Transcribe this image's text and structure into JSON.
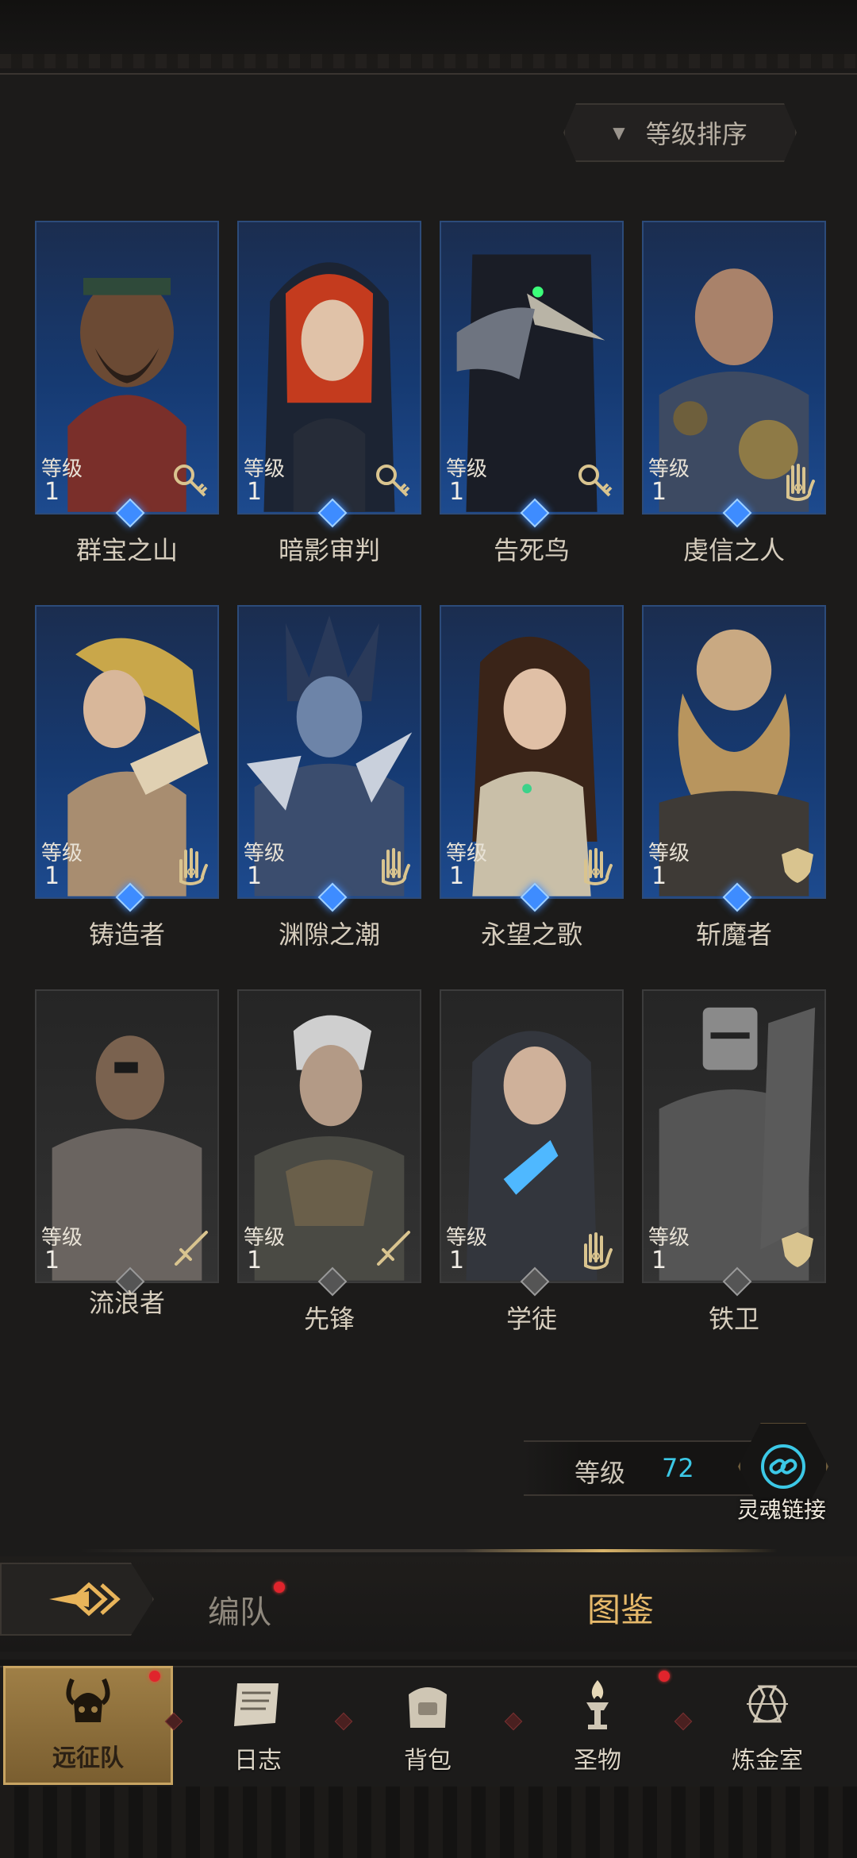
{
  "sort": {
    "label": "等级排序"
  },
  "heroes": [
    {
      "name": "群宝之山",
      "level_label": "等级",
      "level": "1",
      "role": "key-icon"
    },
    {
      "name": "暗影审判",
      "level_label": "等级",
      "level": "1",
      "role": "key-icon"
    },
    {
      "name": "告死鸟",
      "level_label": "等级",
      "level": "1",
      "role": "key-icon"
    },
    {
      "name": "虔信之人",
      "level_label": "等级",
      "level": "1",
      "role": "hand-icon"
    },
    {
      "name": "铸造者",
      "level_label": "等级",
      "level": "1",
      "role": "hand-icon"
    },
    {
      "name": "渊隙之潮",
      "level_label": "等级",
      "level": "1",
      "role": "hand-icon"
    },
    {
      "name": "永望之歌",
      "level_label": "等级",
      "level": "1",
      "role": "hand-icon"
    },
    {
      "name": "斩魔者",
      "level_label": "等级",
      "level": "1",
      "role": "shield-icon"
    },
    {
      "name": "流浪者",
      "level_label": "等级",
      "level": "1",
      "role": "sword-icon"
    },
    {
      "name": "先锋",
      "level_label": "等级",
      "level": "1",
      "role": "sword-icon"
    },
    {
      "name": "学徒",
      "level_label": "等级",
      "level": "1",
      "role": "hand-icon"
    },
    {
      "name": "铁卫",
      "level_label": "等级",
      "level": "1",
      "role": "shield-icon"
    }
  ],
  "level_summary": {
    "label": "等级",
    "value": "72"
  },
  "soul_link": {
    "label": "灵魂链接"
  },
  "tabs": {
    "formation": "编队",
    "codex": "图鉴"
  },
  "nav": [
    {
      "label": "远征队",
      "icon": "viking-helmet-icon"
    },
    {
      "label": "日志",
      "icon": "scroll-icon"
    },
    {
      "label": "背包",
      "icon": "bag-icon"
    },
    {
      "label": "圣物",
      "icon": "torch-icon"
    },
    {
      "label": "炼金室",
      "icon": "alchemy-icon"
    }
  ],
  "colors": {
    "accent_gold": "#e6b96a",
    "rare_blue": "#1d4a8e",
    "level_cyan": "#3cc8e6",
    "notify_red": "#e0242c"
  }
}
